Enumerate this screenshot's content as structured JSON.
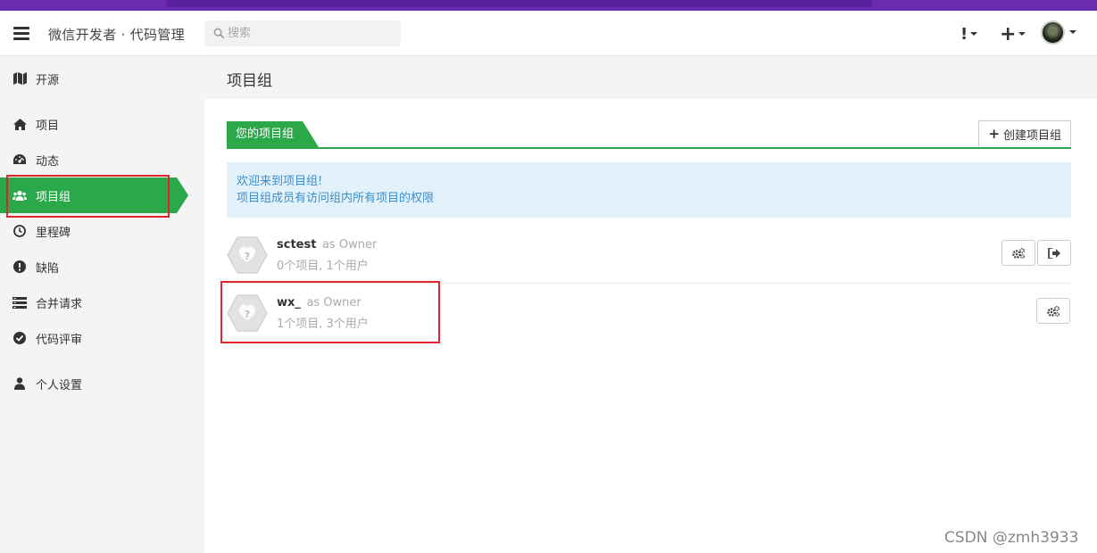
{
  "header": {
    "brand": "微信开发者 · 代码管理",
    "search_placeholder": "搜索",
    "alert_label": "!",
    "create_label": "+"
  },
  "sidebar": {
    "items": [
      {
        "label": "开源",
        "icon": "map-icon"
      },
      {
        "label": "项目",
        "icon": "home-icon"
      },
      {
        "label": "动态",
        "icon": "dashboard-icon"
      },
      {
        "label": "项目组",
        "icon": "users-icon",
        "active": true
      },
      {
        "label": "里程碑",
        "icon": "clock-icon"
      },
      {
        "label": "缺陷",
        "icon": "exclamation-circle-icon"
      },
      {
        "label": "合并请求",
        "icon": "list-icon"
      },
      {
        "label": "代码评审",
        "icon": "check-circle-icon"
      },
      {
        "label": "个人设置",
        "icon": "user-icon"
      }
    ]
  },
  "main": {
    "page_title": "项目组",
    "tab_label": "您的项目组",
    "create_button": "创建项目组",
    "info": {
      "line1": "欢迎来到项目组!",
      "line2": "项目组成员有访问组内所有项目的权限"
    },
    "groups": [
      {
        "name": "sctest",
        "role": "as Owner",
        "meta": "0个项目, 1个用户"
      },
      {
        "name": "wx_",
        "role": "as Owner",
        "meta": "1个项目, 3个用户"
      }
    ]
  },
  "watermark": "CSDN @zmh3933",
  "colors": {
    "accent": "#2ba84a",
    "highlight": "#e0262c",
    "info_bg": "#e3f1fb",
    "info_text": "#3a8fd0"
  }
}
